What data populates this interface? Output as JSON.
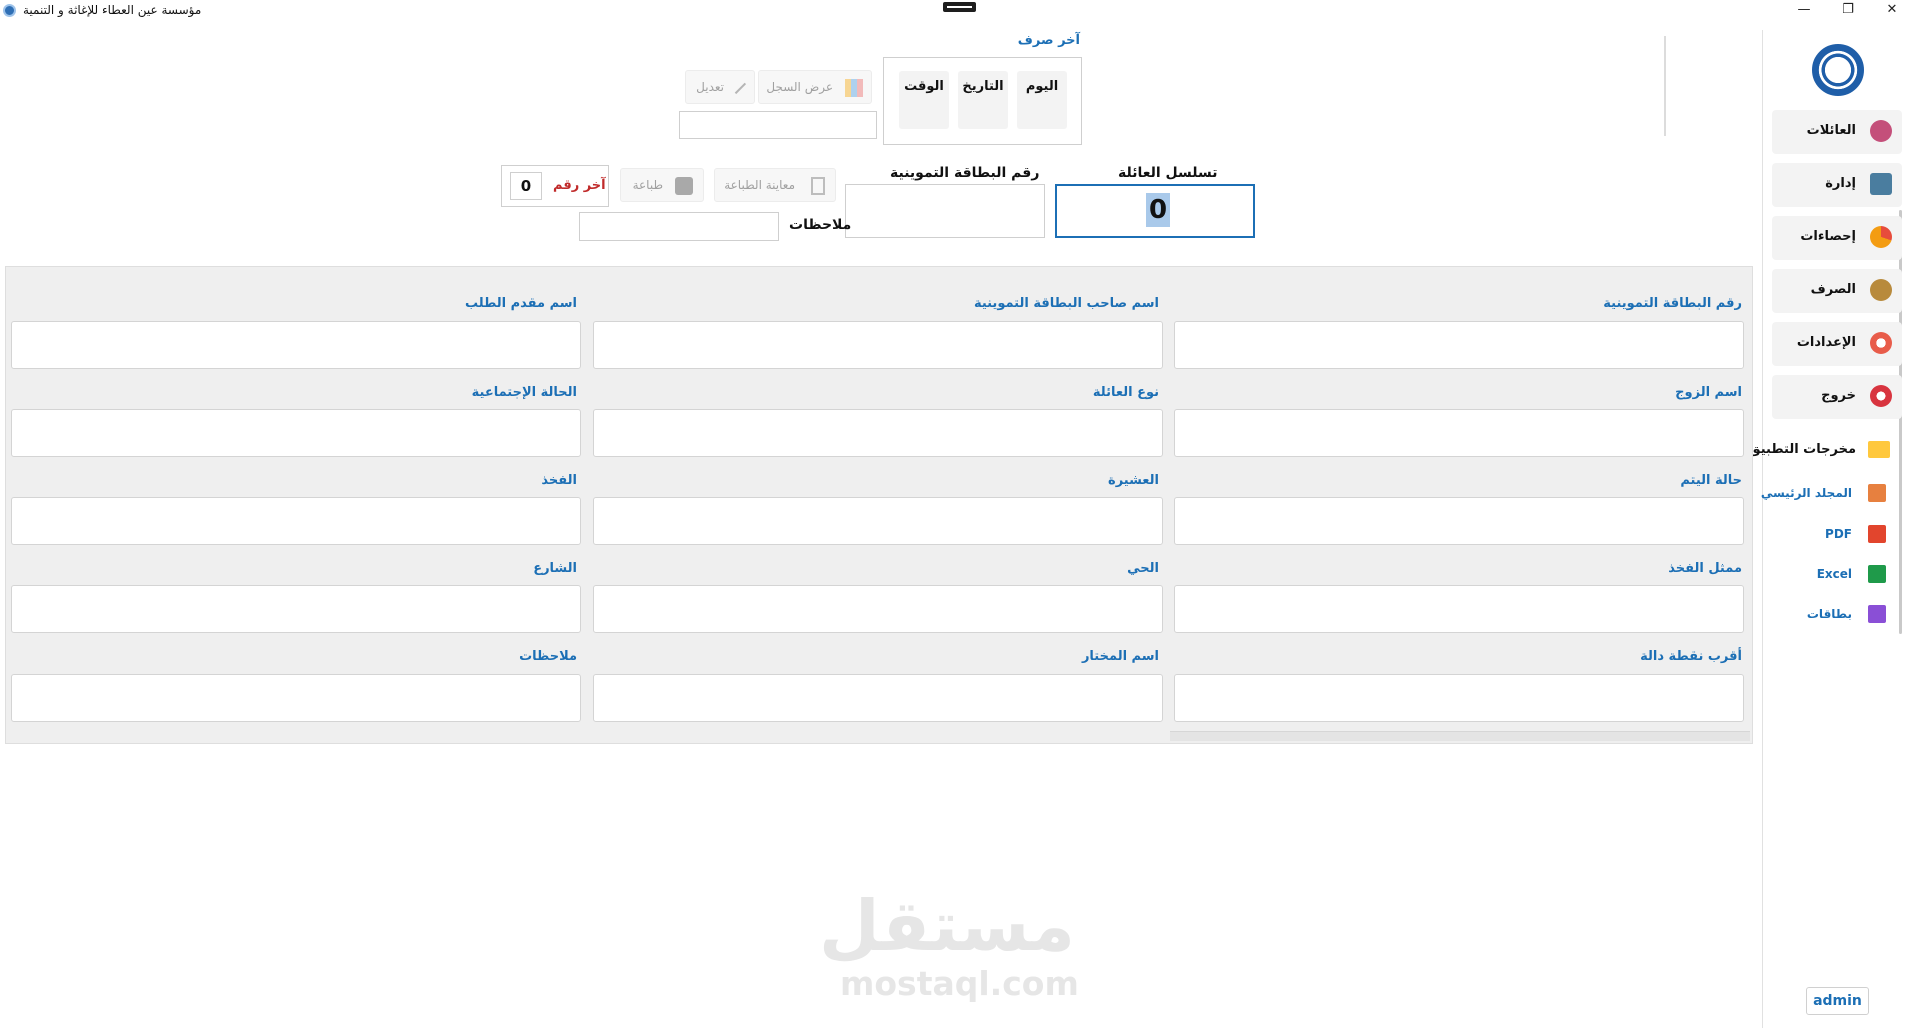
{
  "window": {
    "title": "مؤسسة عين العطاء للإغاثة و التنمية",
    "controls": {
      "minimize": "—",
      "restore": "❐",
      "close": "✕"
    }
  },
  "sidebar": {
    "items": [
      {
        "label": "العائلات",
        "icon": "family-icon",
        "color": "#c44f7a"
      },
      {
        "label": "إدارة",
        "icon": "graduation-cap-icon",
        "color": "#4a7d9f"
      },
      {
        "label": "إحصاءات",
        "icon": "pie-chart-icon",
        "color": "#f39c12"
      },
      {
        "label": "الصرف",
        "icon": "money-hand-icon",
        "color": "#b88a3c"
      },
      {
        "label": "الإعدادات",
        "icon": "gear-icon",
        "color": "#e85c4a"
      },
      {
        "label": "خروج",
        "icon": "exit-icon",
        "color": "#d8343f"
      }
    ],
    "outputs_label": "مخرجات التطبيق",
    "outputs": [
      {
        "label": "المجلد الرئيسي",
        "icon": "home-folder-icon",
        "color": "#e7803f"
      },
      {
        "label": "PDF",
        "icon": "pdf-icon",
        "color": "#e2452d"
      },
      {
        "label": "Excel",
        "icon": "excel-icon",
        "color": "#1f9a4a"
      },
      {
        "label": "بطاقات",
        "icon": "id-card-icon",
        "color": "#8a4fd6"
      }
    ],
    "user": "admin"
  },
  "last_disbursement": {
    "title": "آخر صرف",
    "day": "اليوم",
    "date": "التاريخ",
    "time": "الوقت"
  },
  "toolbar": {
    "view_log": "عرض السجل",
    "edit": "تعديل",
    "print_preview": "معاينة الطباعة",
    "print": "طباعة",
    "last_number_label": "آخر رقم",
    "last_number_value": "0"
  },
  "search": {
    "family_seq_label": "تسلسل العائلة",
    "family_seq_value": "0",
    "ration_card_label": "رقم البطاقة التموينية",
    "notes_label": "ملاحظات"
  },
  "form": {
    "rows": [
      [
        "رقم البطاقة التموينية",
        "اسم صاحب البطاقة التموينية",
        "اسم مقدم الطلب"
      ],
      [
        "اسم الزوج",
        "نوع العائلة",
        "الحالة الإجتماعية"
      ],
      [
        "حالة اليتم",
        "العشيرة",
        "الفخذ"
      ],
      [
        "ممثل الفخذ",
        "الحي",
        "الشارع"
      ],
      [
        "أقرب نقطة دالة",
        "اسم المختار",
        "ملاحظات"
      ]
    ]
  },
  "watermark": {
    "arabic": "مستقل",
    "latin": "mostaql.com"
  }
}
